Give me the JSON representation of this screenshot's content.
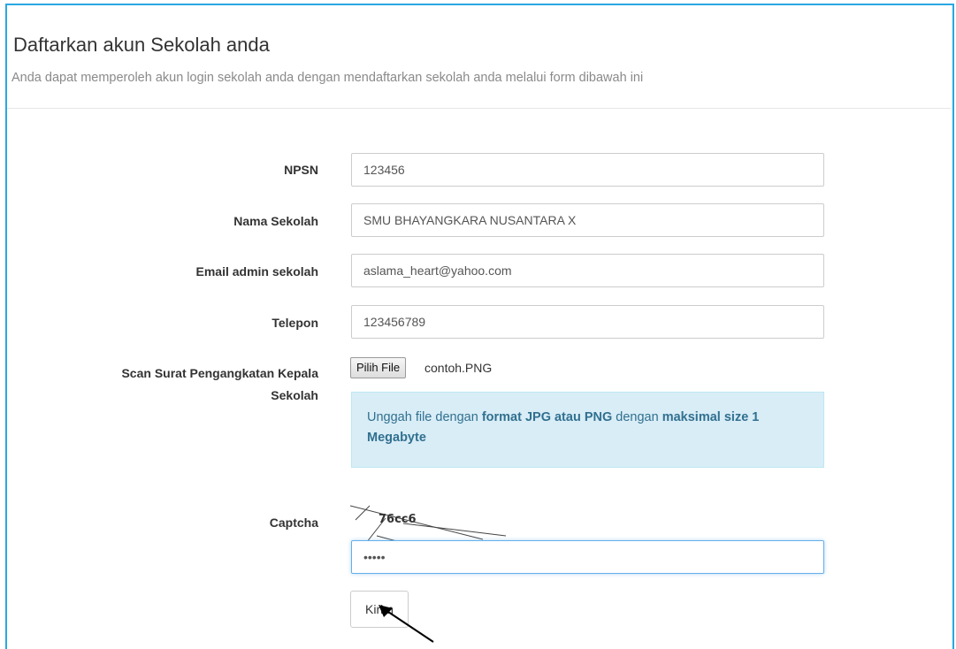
{
  "header": {
    "title": "Daftarkan akun Sekolah anda",
    "subtitle": "Anda dapat memperoleh akun login sekolah anda dengan mendaftarkan sekolah anda melalui form dibawah ini"
  },
  "form": {
    "npsn": {
      "label": "NPSN",
      "value": "123456"
    },
    "nama_sekolah": {
      "label": "Nama Sekolah",
      "value": "SMU BHAYANGKARA NUSANTARA X"
    },
    "email": {
      "label": "Email admin sekolah",
      "value": "aslama_heart@yahoo.com"
    },
    "telepon": {
      "label": "Telepon",
      "value": "123456789"
    },
    "scan": {
      "label_line1": "Scan Surat Pengangkatan Kepala",
      "label_line2": "Sekolah",
      "button_label": "Pilih File",
      "file_name": "contoh.PNG"
    },
    "info": {
      "text1": "Unggah file dengan ",
      "bold1": "format JPG atau PNG",
      "text2": " dengan ",
      "bold2": "maksimal size 1 Megabyte"
    },
    "captcha": {
      "label": "Captcha",
      "image_text": "76cc6",
      "value": "•••••"
    },
    "submit_label": "Kirim"
  },
  "colors": {
    "frame_border": "#2aa7e2",
    "info_background": "#d9edf7",
    "info_text": "#31708f"
  },
  "icons": {
    "pointer": "mouse-pointer-icon"
  }
}
